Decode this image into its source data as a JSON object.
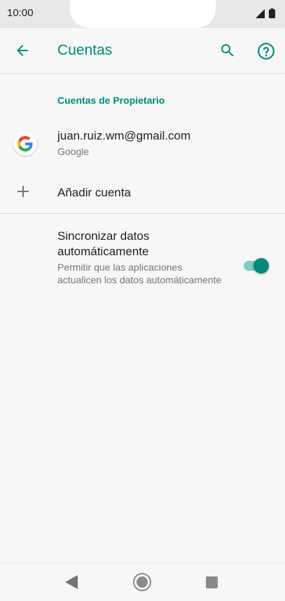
{
  "status_bar": {
    "time": "10:00"
  },
  "app_bar": {
    "title": "Cuentas",
    "icons": [
      "back-arrow-icon",
      "search-icon",
      "help-icon"
    ]
  },
  "accounts_section": {
    "header": "Cuentas de Propietario",
    "items": [
      {
        "email": "juan.ruiz.wm@gmail.com",
        "type": "Google",
        "icon": "google-logo-icon"
      }
    ]
  },
  "add_account": {
    "label": "Añadir cuenta",
    "icon": "plus-icon"
  },
  "sync": {
    "title": "Sincronizar datos automáticamente",
    "description": "Permitir que las aplicaciones actualicen los datos automáticamente",
    "enabled": true
  },
  "nav_bar": {
    "icons": [
      "nav-back-icon",
      "nav-home-icon",
      "nav-recents-icon"
    ]
  },
  "colors": {
    "accent": "#00897b",
    "toggle_track": "#80cbc4",
    "background": "#f7f7f7"
  }
}
